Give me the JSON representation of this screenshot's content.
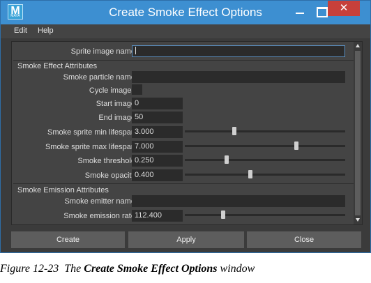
{
  "window": {
    "icon_letter": "M",
    "icon_sub": "MAYA",
    "title": "Create Smoke Effect Options"
  },
  "menu": {
    "edit": "Edit",
    "help": "Help"
  },
  "fields": {
    "sprite_image_name_label": "Sprite image name:",
    "sprite_image_name_value": "",
    "section_attributes": "Smoke Effect Attributes",
    "smoke_particle_name_label": "Smoke particle name:",
    "smoke_particle_name_value": "",
    "cycle_images_label": "Cycle images:",
    "start_image_label": "Start image:",
    "start_image_value": "0",
    "end_image_label": "End image:",
    "end_image_value": "50",
    "min_lifespan_label": "Smoke sprite min lifespan:",
    "min_lifespan_value": "3.000",
    "max_lifespan_label": "Smoke sprite max lifespan:",
    "max_lifespan_value": "7.000",
    "threshold_label": "Smoke threshold:",
    "threshold_value": "0.250",
    "opacity_label": "Smoke opacity:",
    "opacity_value": "0.400",
    "section_emission": "Smoke Emission Attributes",
    "emitter_name_label": "Smoke emitter name:",
    "emitter_name_value": "",
    "emission_rate_label": "Smoke emission rate:",
    "emission_rate_value": "112.400"
  },
  "buttons": {
    "create": "Create",
    "apply": "Apply",
    "close": "Close"
  },
  "caption": {
    "figure": "Figure 12-23",
    "the": "The",
    "name": "Create Smoke Effect Options",
    "rest": "window"
  }
}
